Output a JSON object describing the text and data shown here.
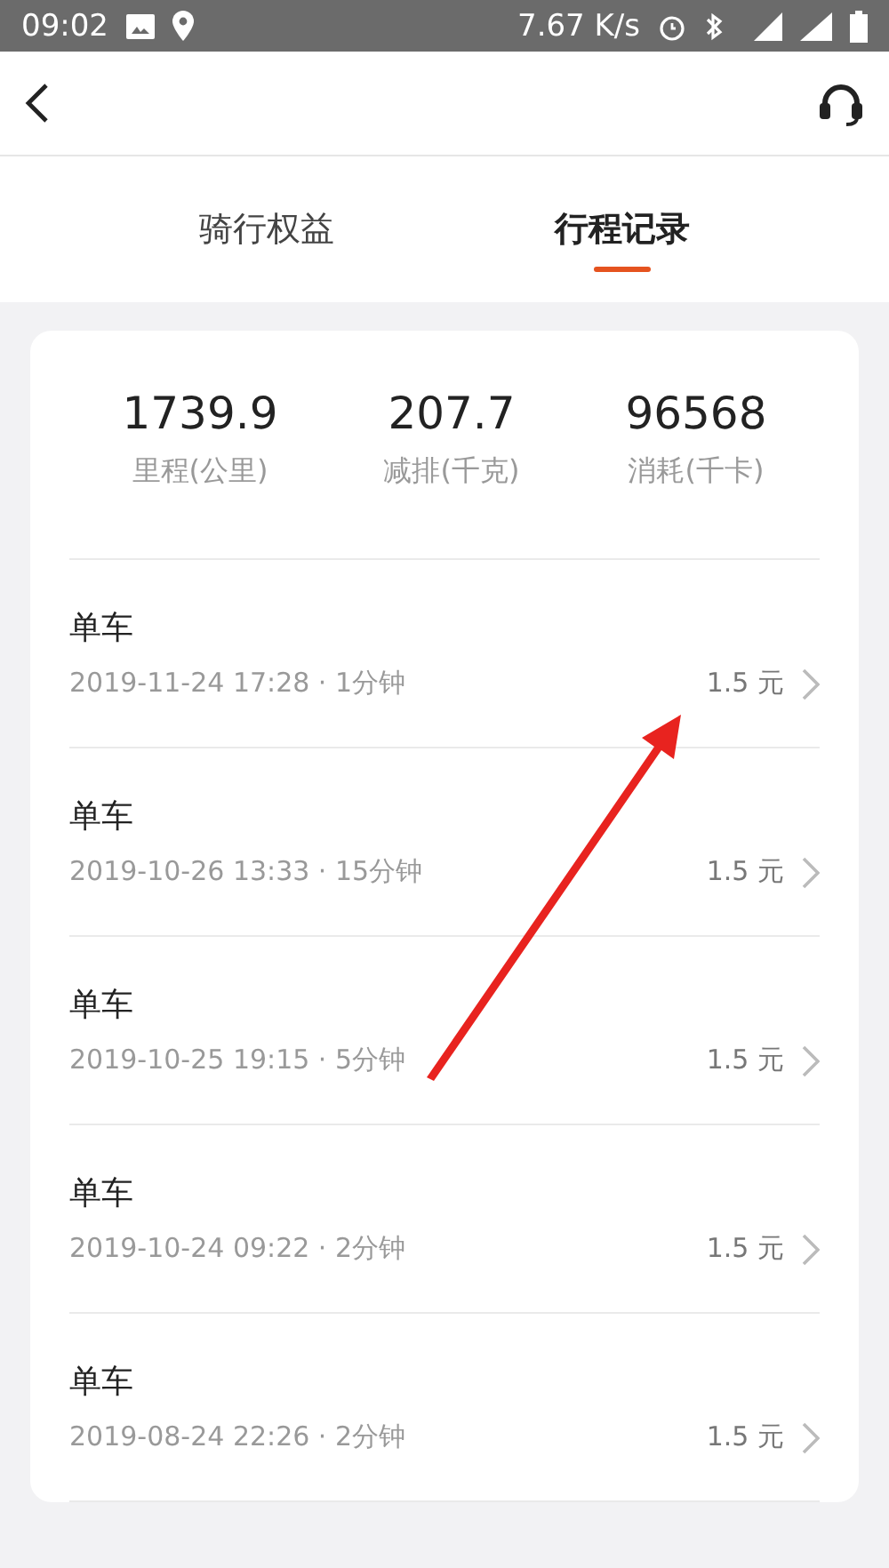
{
  "status_bar": {
    "time": "09:02",
    "speed": "7.67 K/s"
  },
  "tabs": [
    {
      "label": "骑行权益",
      "selected": false
    },
    {
      "label": "行程记录",
      "selected": true
    }
  ],
  "stats": [
    {
      "value": "1739.9",
      "label": "里程(公里)"
    },
    {
      "value": "207.7",
      "label": "减排(千克)"
    },
    {
      "value": "96568",
      "label": "消耗(千卡)"
    }
  ],
  "trips": [
    {
      "title": "单车",
      "meta": "2019-11-24 17:28 · 1分钟",
      "price": "1.5 元"
    },
    {
      "title": "单车",
      "meta": "2019-10-26 13:33 · 15分钟",
      "price": "1.5 元"
    },
    {
      "title": "单车",
      "meta": "2019-10-25 19:15 · 5分钟",
      "price": "1.5 元"
    },
    {
      "title": "单车",
      "meta": "2019-10-24 09:22 · 2分钟",
      "price": "1.5 元"
    },
    {
      "title": "单车",
      "meta": "2019-08-24 22:26 · 2分钟",
      "price": "1.5 元"
    }
  ]
}
